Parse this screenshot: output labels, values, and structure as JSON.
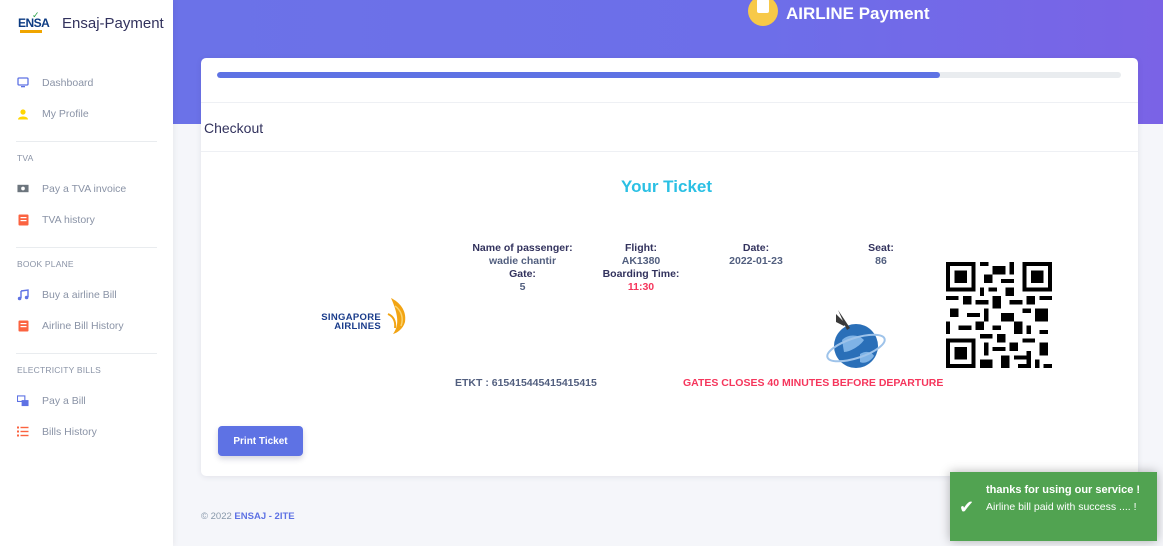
{
  "sidebar": {
    "brand": {
      "logo_text": "ENSA",
      "name": "Ensaj-Payment"
    },
    "main_items": [
      {
        "label": "Dashboard",
        "icon": "monitor-icon",
        "color": "#5e72e4"
      },
      {
        "label": "My Profile",
        "icon": "user-icon",
        "color": "#ffd600"
      }
    ],
    "sections": [
      {
        "heading": "TVA",
        "items": [
          {
            "label": "Pay a TVA invoice",
            "icon": "money-icon",
            "color": "#6c757d"
          },
          {
            "label": "TVA history",
            "icon": "history-icon",
            "color": "#fb6340"
          }
        ]
      },
      {
        "heading": "BOOK PLANE",
        "items": [
          {
            "label": "Buy a airline Bill",
            "icon": "music-note-icon",
            "color": "#5e72e4"
          },
          {
            "label": "Airline Bill History",
            "icon": "history-icon",
            "color": "#fb6340"
          }
        ]
      },
      {
        "heading": "ELECTRICITY BILLS",
        "items": [
          {
            "label": "Pay a Bill",
            "icon": "monitor-window-icon",
            "color": "#5e72e4"
          },
          {
            "label": "Bills History",
            "icon": "list-icon",
            "color": "#fb6340"
          }
        ]
      }
    ]
  },
  "header": {
    "title": "AIRLINE Payment"
  },
  "card": {
    "progress_fraction": 0.8,
    "checkout_label": "Checkout",
    "ticket_title": "Your Ticket",
    "passenger_label": "Name of passenger:",
    "passenger_value": "wadie chantir",
    "gate_label": "Gate:",
    "gate_value": "5",
    "flight_label": "Flight:",
    "flight_value": "AK1380",
    "boarding_label": "Boarding Time:",
    "boarding_value": "11:30",
    "date_label": "Date:",
    "date_value": "2022-01-23",
    "seat_label": "Seat:",
    "seat_value": "86",
    "airline_logo_line1": "SINGAPORE",
    "airline_logo_line2": "AIRLINES",
    "etkt": "ETKT : 615415445415415415",
    "gates_notice": "GATES CLOSES 40 MINUTES BEFORE DEPARTURE",
    "print_button": "Print Ticket"
  },
  "footer": {
    "copyright": "© 2022",
    "brand": "ENSAJ - 2ITE"
  },
  "toast": {
    "title": "thanks for using our service !",
    "message": "Airline bill paid with success .... !"
  },
  "colors": {
    "accent": "#5e72e4",
    "toast": "#51a351",
    "ticket_title": "#2bc0e4",
    "alert": "#f5365c"
  }
}
